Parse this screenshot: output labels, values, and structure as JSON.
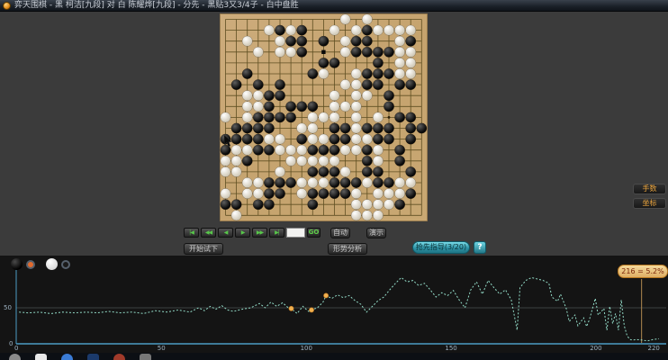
{
  "title_bar": {
    "title": "弈天围棋 - 黑 柯洁[九段] 对 白 陈耀烨[九段] - 分先 - 黑贴3又3/4子 - 白中盘胜",
    "app_icon": "go-app-icon"
  },
  "board": {
    "size": 19,
    "wood_color": "#c8a774",
    "line_color": "#5f4f22",
    "star_points": [
      [
        3,
        3
      ],
      [
        9,
        3
      ],
      [
        15,
        3
      ],
      [
        3,
        9
      ],
      [
        9,
        9
      ],
      [
        15,
        9
      ],
      [
        3,
        15
      ],
      [
        9,
        15
      ],
      [
        15,
        15
      ]
    ],
    "marker": {
      "col": 9,
      "row": 3,
      "type": "square"
    },
    "black_stones": [
      [
        5,
        1
      ],
      [
        7,
        1
      ],
      [
        13,
        1
      ],
      [
        6,
        2
      ],
      [
        7,
        2
      ],
      [
        9,
        2
      ],
      [
        12,
        2
      ],
      [
        13,
        2
      ],
      [
        17,
        2
      ],
      [
        7,
        3
      ],
      [
        12,
        3
      ],
      [
        13,
        3
      ],
      [
        14,
        3
      ],
      [
        15,
        3
      ],
      [
        9,
        4
      ],
      [
        10,
        4
      ],
      [
        14,
        4
      ],
      [
        2,
        5
      ],
      [
        8,
        5
      ],
      [
        13,
        5
      ],
      [
        14,
        5
      ],
      [
        15,
        5
      ],
      [
        1,
        6
      ],
      [
        3,
        6
      ],
      [
        5,
        6
      ],
      [
        13,
        6
      ],
      [
        14,
        6
      ],
      [
        16,
        6
      ],
      [
        17,
        6
      ],
      [
        4,
        7
      ],
      [
        5,
        7
      ],
      [
        15,
        7
      ],
      [
        4,
        8
      ],
      [
        6,
        8
      ],
      [
        7,
        8
      ],
      [
        8,
        8
      ],
      [
        15,
        8
      ],
      [
        3,
        9
      ],
      [
        4,
        9
      ],
      [
        5,
        9
      ],
      [
        6,
        9
      ],
      [
        16,
        9
      ],
      [
        17,
        9
      ],
      [
        1,
        10
      ],
      [
        2,
        10
      ],
      [
        3,
        10
      ],
      [
        4,
        10
      ],
      [
        10,
        10
      ],
      [
        11,
        10
      ],
      [
        13,
        10
      ],
      [
        14,
        10
      ],
      [
        15,
        10
      ],
      [
        17,
        10
      ],
      [
        18,
        10
      ],
      [
        0,
        11
      ],
      [
        1,
        11
      ],
      [
        2,
        11
      ],
      [
        3,
        11
      ],
      [
        7,
        11
      ],
      [
        10,
        11
      ],
      [
        11,
        11
      ],
      [
        14,
        11
      ],
      [
        15,
        11
      ],
      [
        17,
        11
      ],
      [
        0,
        12
      ],
      [
        3,
        12
      ],
      [
        4,
        12
      ],
      [
        8,
        12
      ],
      [
        9,
        12
      ],
      [
        10,
        12
      ],
      [
        13,
        12
      ],
      [
        16,
        12
      ],
      [
        2,
        13
      ],
      [
        13,
        13
      ],
      [
        16,
        13
      ],
      [
        8,
        14
      ],
      [
        9,
        14
      ],
      [
        10,
        14
      ],
      [
        13,
        14
      ],
      [
        14,
        14
      ],
      [
        17,
        14
      ],
      [
        4,
        15
      ],
      [
        5,
        15
      ],
      [
        6,
        15
      ],
      [
        10,
        15
      ],
      [
        11,
        15
      ],
      [
        12,
        15
      ],
      [
        14,
        15
      ],
      [
        15,
        15
      ],
      [
        4,
        16
      ],
      [
        5,
        16
      ],
      [
        8,
        16
      ],
      [
        9,
        16
      ],
      [
        10,
        16
      ],
      [
        11,
        16
      ],
      [
        17,
        16
      ],
      [
        0,
        17
      ],
      [
        1,
        17
      ],
      [
        3,
        17
      ],
      [
        4,
        17
      ],
      [
        8,
        17
      ],
      [
        16,
        17
      ]
    ],
    "white_stones": [
      [
        11,
        0
      ],
      [
        13,
        0
      ],
      [
        4,
        1
      ],
      [
        6,
        1
      ],
      [
        10,
        1
      ],
      [
        12,
        1
      ],
      [
        14,
        1
      ],
      [
        15,
        1
      ],
      [
        16,
        1
      ],
      [
        17,
        1
      ],
      [
        2,
        2
      ],
      [
        5,
        2
      ],
      [
        11,
        2
      ],
      [
        16,
        2
      ],
      [
        3,
        3
      ],
      [
        5,
        3
      ],
      [
        6,
        3
      ],
      [
        11,
        3
      ],
      [
        16,
        3
      ],
      [
        17,
        3
      ],
      [
        16,
        4
      ],
      [
        17,
        4
      ],
      [
        9,
        5
      ],
      [
        12,
        5
      ],
      [
        16,
        5
      ],
      [
        17,
        5
      ],
      [
        11,
        6
      ],
      [
        12,
        6
      ],
      [
        2,
        7
      ],
      [
        3,
        7
      ],
      [
        10,
        7
      ],
      [
        12,
        7
      ],
      [
        13,
        7
      ],
      [
        2,
        8
      ],
      [
        3,
        8
      ],
      [
        10,
        8
      ],
      [
        11,
        8
      ],
      [
        12,
        8
      ],
      [
        0,
        9
      ],
      [
        2,
        9
      ],
      [
        8,
        9
      ],
      [
        9,
        9
      ],
      [
        10,
        9
      ],
      [
        12,
        9
      ],
      [
        14,
        9
      ],
      [
        7,
        10
      ],
      [
        8,
        10
      ],
      [
        12,
        10
      ],
      [
        4,
        11
      ],
      [
        5,
        11
      ],
      [
        8,
        11
      ],
      [
        9,
        11
      ],
      [
        12,
        11
      ],
      [
        13,
        11
      ],
      [
        1,
        12
      ],
      [
        2,
        12
      ],
      [
        5,
        12
      ],
      [
        6,
        12
      ],
      [
        7,
        12
      ],
      [
        11,
        12
      ],
      [
        12,
        12
      ],
      [
        14,
        12
      ],
      [
        0,
        13
      ],
      [
        1,
        13
      ],
      [
        6,
        13
      ],
      [
        7,
        13
      ],
      [
        8,
        13
      ],
      [
        9,
        13
      ],
      [
        10,
        13
      ],
      [
        14,
        13
      ],
      [
        0,
        14
      ],
      [
        1,
        14
      ],
      [
        5,
        14
      ],
      [
        11,
        14
      ],
      [
        2,
        15
      ],
      [
        3,
        15
      ],
      [
        7,
        15
      ],
      [
        8,
        15
      ],
      [
        9,
        15
      ],
      [
        13,
        15
      ],
      [
        16,
        15
      ],
      [
        17,
        15
      ],
      [
        0,
        16
      ],
      [
        2,
        16
      ],
      [
        3,
        16
      ],
      [
        7,
        16
      ],
      [
        12,
        16
      ],
      [
        14,
        16
      ],
      [
        15,
        16
      ],
      [
        16,
        16
      ],
      [
        12,
        17
      ],
      [
        13,
        17
      ],
      [
        14,
        17
      ],
      [
        15,
        17
      ],
      [
        1,
        18
      ],
      [
        12,
        18
      ],
      [
        13,
        18
      ],
      [
        14,
        18
      ]
    ]
  },
  "controls": {
    "nav_buttons": [
      {
        "name": "first-move-button",
        "glyph": "|◀"
      },
      {
        "name": "back-fast-button",
        "glyph": "◀◀"
      },
      {
        "name": "back-button",
        "glyph": "◀"
      },
      {
        "name": "forward-button",
        "glyph": "▶"
      },
      {
        "name": "forward-fast-button",
        "glyph": "▶▶"
      },
      {
        "name": "last-move-button",
        "glyph": "▶|"
      }
    ],
    "move_input_value": "",
    "go_label": "GO",
    "auto_label": "自动",
    "demo_label": "演示",
    "trial_label": "开始试下",
    "analysis_label": "形势分析",
    "guide_label": "抢先指导(3/20)",
    "help_label": "?"
  },
  "side_buttons": {
    "moves_label": "手数",
    "coords_label": "坐标"
  },
  "chart_data": {
    "type": "line",
    "title": "",
    "xlabel": "",
    "ylabel": "",
    "xlim": [
      0,
      224
    ],
    "ylim": [
      0,
      100
    ],
    "x_ticks": [
      0,
      50,
      100,
      150,
      200,
      220
    ],
    "y_ticks": [
      0,
      50
    ],
    "grid_50pct_line": true,
    "legend": [
      {
        "name": "black-winrate",
        "selected": true
      },
      {
        "name": "white-winrate",
        "selected": false
      }
    ],
    "line_color": "#93dcc8",
    "axis_color": "#4d9cc4",
    "series": [
      {
        "name": "black_win_rate_pct",
        "points": [
          [
            1,
            44
          ],
          [
            4,
            43
          ],
          [
            8,
            44
          ],
          [
            12,
            42
          ],
          [
            16,
            44
          ],
          [
            20,
            43
          ],
          [
            24,
            44
          ],
          [
            28,
            43
          ],
          [
            32,
            45
          ],
          [
            36,
            43
          ],
          [
            40,
            44
          ],
          [
            44,
            42
          ],
          [
            48,
            46
          ],
          [
            52,
            44
          ],
          [
            56,
            47
          ],
          [
            60,
            44
          ],
          [
            63,
            50
          ],
          [
            65,
            46
          ],
          [
            67,
            52
          ],
          [
            69,
            48
          ],
          [
            71,
            53
          ],
          [
            73,
            47
          ],
          [
            75,
            45
          ],
          [
            78,
            48
          ],
          [
            81,
            50
          ],
          [
            84,
            56
          ],
          [
            86,
            50
          ],
          [
            88,
            58
          ],
          [
            90,
            52
          ],
          [
            92,
            57
          ],
          [
            94,
            50
          ],
          [
            95,
            49
          ],
          [
            97,
            42
          ],
          [
            99,
            52
          ],
          [
            101,
            45
          ],
          [
            102,
            47
          ],
          [
            104,
            50
          ],
          [
            106,
            58
          ],
          [
            107,
            67
          ],
          [
            109,
            63
          ],
          [
            111,
            68
          ],
          [
            113,
            64
          ],
          [
            115,
            67
          ],
          [
            117,
            60
          ],
          [
            119,
            55
          ],
          [
            121,
            44
          ],
          [
            123,
            52
          ],
          [
            125,
            60
          ],
          [
            127,
            65
          ],
          [
            129,
            75
          ],
          [
            131,
            84
          ],
          [
            133,
            92
          ],
          [
            135,
            86
          ],
          [
            137,
            88
          ],
          [
            139,
            81
          ],
          [
            141,
            84
          ],
          [
            143,
            75
          ],
          [
            145,
            65
          ],
          [
            147,
            71
          ],
          [
            149,
            67
          ],
          [
            151,
            74
          ],
          [
            153,
            61
          ],
          [
            155,
            50
          ],
          [
            157,
            75
          ],
          [
            159,
            86
          ],
          [
            161,
            69
          ],
          [
            163,
            88
          ],
          [
            165,
            78
          ],
          [
            167,
            69
          ],
          [
            169,
            75
          ],
          [
            171,
            61
          ],
          [
            173,
            19
          ],
          [
            174,
            78
          ],
          [
            176,
            88
          ],
          [
            178,
            92
          ],
          [
            180,
            90
          ],
          [
            182,
            88
          ],
          [
            184,
            84
          ],
          [
            185,
            65
          ],
          [
            187,
            59
          ],
          [
            188,
            69
          ],
          [
            190,
            49
          ],
          [
            191,
            31
          ],
          [
            193,
            40
          ],
          [
            194,
            25
          ],
          [
            196,
            36
          ],
          [
            197,
            24
          ],
          [
            198,
            34
          ],
          [
            200,
            63
          ],
          [
            201,
            40
          ],
          [
            203,
            49
          ],
          [
            204,
            19
          ],
          [
            205,
            52
          ],
          [
            206,
            28
          ],
          [
            207,
            42
          ],
          [
            208,
            19
          ],
          [
            209,
            61
          ],
          [
            210,
            25
          ],
          [
            211,
            11
          ],
          [
            212,
            6
          ],
          [
            213,
            5
          ],
          [
            214,
            6
          ],
          [
            216,
            5.2
          ],
          [
            218,
            4
          ],
          [
            220,
            6
          ],
          [
            222,
            7
          ]
        ]
      }
    ],
    "markers": [
      {
        "move": 95,
        "value": 49
      },
      {
        "move": 102,
        "value": 47
      },
      {
        "move": 107,
        "value": 67
      }
    ],
    "tooltip": {
      "move": 216,
      "value_pct": 5.2,
      "label": "216 = 5.2%"
    }
  },
  "taskbar": {
    "icons": [
      {
        "name": "taskbar-icon-1",
        "color": "#8a8a8a"
      },
      {
        "name": "taskbar-icon-2",
        "color": "#e8e8e8"
      },
      {
        "name": "taskbar-icon-3",
        "color": "#3a7bd5"
      },
      {
        "name": "taskbar-icon-4",
        "color": "#1b3a6b"
      },
      {
        "name": "taskbar-icon-5",
        "color": "#a03a2a"
      },
      {
        "name": "taskbar-icon-6",
        "color": "#777777"
      }
    ]
  }
}
